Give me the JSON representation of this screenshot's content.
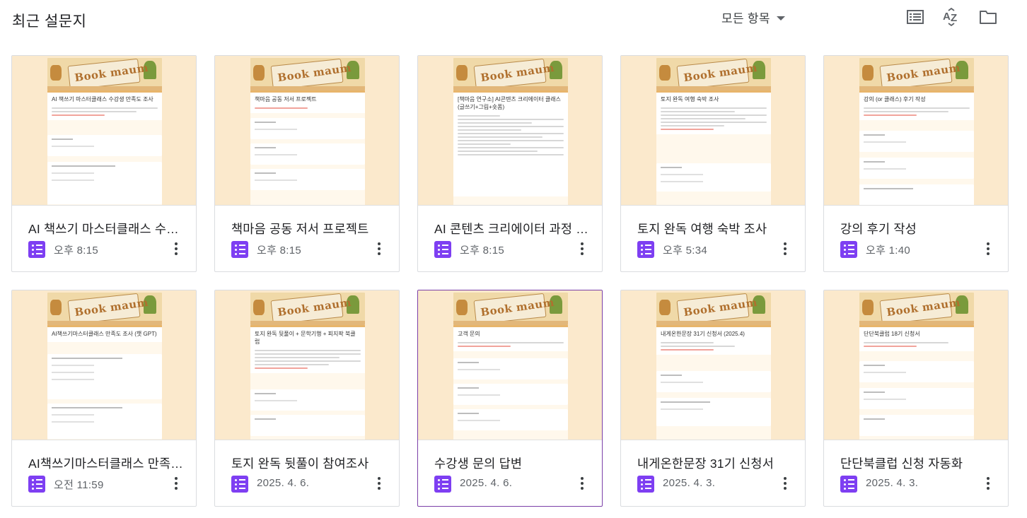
{
  "header": {
    "title": "최근 설문지",
    "filter_label": "모든 항목",
    "list_view_icon": "list-view-icon",
    "sort_icon": "sort-az-icon",
    "folder_icon": "folder-icon"
  },
  "colors": {
    "forms_purple": "#7e3ff2",
    "thumb_bg": "#fbe9cc",
    "selected_border": "#7b3fa8"
  },
  "cards": [
    {
      "title": "AI 책쓰기 마스터클래스 수강생 만족도 조사",
      "time": "오후 8:15",
      "form_title": "AI 책쓰기 마스터클래스 수강생 만족도 조사",
      "logo": "Book maum"
    },
    {
      "title": "책마음 공동 저서 프로젝트",
      "time": "오후 8:15",
      "form_title": "책마음 공동 저서 프로젝트",
      "logo": "Book maum"
    },
    {
      "title": "AI 콘텐츠 크리에이터 과정 신청서",
      "time": "오후 8:15",
      "form_title": "[책마음 연구소] AI콘텐츠 크리에이터 클래스 (글쓰기+그림+숏폼)",
      "logo": "Book maum"
    },
    {
      "title": "토지 완독 여행 숙박 조사",
      "time": "오후 5:34",
      "form_title": "토지 완독 여행 숙박 조사",
      "logo": "Book maum"
    },
    {
      "title": "강의 후기 작성",
      "time": "오후 1:40",
      "form_title": "강의 (or 클래스) 후기 작성",
      "logo": "Book maum"
    },
    {
      "title": "AI책쓰기마스터클래스 만족도 조사",
      "time": "오전 11:59",
      "form_title": "AI책쓰기마스터클래스 만족도 조사 (챗 GPT)",
      "logo": "Book maum"
    },
    {
      "title": "토지 완독 뒷풀이 참여조사",
      "time": "2025. 4. 6.",
      "form_title": "토지 완독 뒷풀이 + 문학기행 + 피지팍 북클럽",
      "logo": "Book maum"
    },
    {
      "title": "수강생 문의 답변",
      "time": "2025. 4. 6.",
      "form_title": "고객 문의",
      "logo": "Book maum"
    },
    {
      "title": "내게온한문장 31기 신청서",
      "time": "2025. 4. 3.",
      "form_title": "내게온한문장 31기 신청서 (2025.4)",
      "logo": "Book maum"
    },
    {
      "title": "단단북클럽 신청 자동화",
      "time": "2025. 4. 3.",
      "form_title": "단단북클럽 18기 신청서",
      "logo": "Book maum"
    }
  ]
}
